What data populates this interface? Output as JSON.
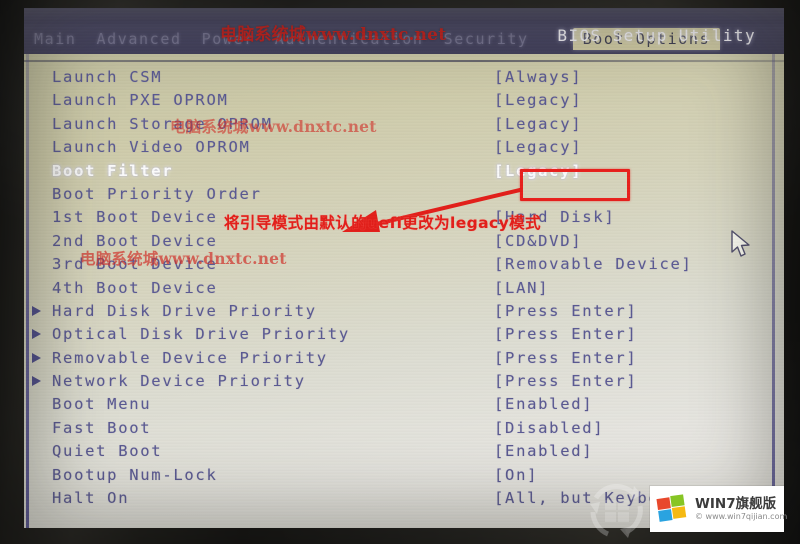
{
  "window": {
    "title": "BIOS Setup Utility"
  },
  "menubar": {
    "tabs": [
      {
        "label": "Main",
        "active": false
      },
      {
        "label": "Advanced",
        "active": false
      },
      {
        "label": "Power",
        "active": false
      },
      {
        "label": "Authentication",
        "active": false
      },
      {
        "label": "Security",
        "active": false
      },
      {
        "label": "Boot Options",
        "active": true
      }
    ]
  },
  "settings": {
    "rows": [
      {
        "label": "Launch CSM",
        "value": "[Always]",
        "arrow": false,
        "selected": false
      },
      {
        "label": "Launch PXE OPROM",
        "value": "[Legacy]",
        "arrow": false,
        "selected": false
      },
      {
        "label": "Launch Storage OPROM",
        "value": "[Legacy]",
        "arrow": false,
        "selected": false
      },
      {
        "label": "Launch Video OPROM",
        "value": "[Legacy]",
        "arrow": false,
        "selected": false
      },
      {
        "label": "Boot Filter",
        "value": "[Legacy]",
        "arrow": false,
        "selected": true
      },
      {
        "label": "Boot Priority Order",
        "value": "",
        "arrow": false,
        "selected": false
      },
      {
        "label": "1st Boot Device",
        "value": "[Hard Disk]",
        "arrow": false,
        "selected": false
      },
      {
        "label": "2nd Boot Device",
        "value": "[CD&DVD]",
        "arrow": false,
        "selected": false
      },
      {
        "label": "3rd Boot Device",
        "value": "[Removable Device]",
        "arrow": false,
        "selected": false
      },
      {
        "label": "4th Boot Device",
        "value": "[LAN]",
        "arrow": false,
        "selected": false
      },
      {
        "label": "Hard Disk Drive Priority",
        "value": "[Press Enter]",
        "arrow": true,
        "selected": false
      },
      {
        "label": "Optical Disk Drive Priority",
        "value": "[Press Enter]",
        "arrow": true,
        "selected": false
      },
      {
        "label": "Removable Device Priority",
        "value": "[Press Enter]",
        "arrow": true,
        "selected": false
      },
      {
        "label": "Network Device Priority",
        "value": "[Press Enter]",
        "arrow": true,
        "selected": false
      },
      {
        "label": "Boot Menu",
        "value": "[Enabled]",
        "arrow": false,
        "selected": false
      },
      {
        "label": "Fast Boot",
        "value": "[Disabled]",
        "arrow": false,
        "selected": false
      },
      {
        "label": "Quiet Boot",
        "value": "[Enabled]",
        "arrow": false,
        "selected": false
      },
      {
        "label": "Bootup Num-Lock",
        "value": "[On]",
        "arrow": false,
        "selected": false
      },
      {
        "label": "Halt On",
        "value": "[All, but Keyboard]",
        "arrow": false,
        "selected": false
      }
    ]
  },
  "annotation": {
    "text": "将引导模式由默认的uefi更改为legacy模式",
    "color": "#e31f1a",
    "highlight_target": "[Legacy]"
  },
  "watermarks": [
    {
      "text": "电脑系统城www.dnxtc.net"
    },
    {
      "text": "电脑系统城www.dnxtc.net"
    },
    {
      "text": "电脑系统城www.dnxtc.net"
    }
  ],
  "badge": {
    "title": "WIN7旗舰版",
    "subtitle": "© www.win7qijian.com"
  },
  "colors": {
    "panel_bg": "#d6d4bc",
    "text": "#5b5a93",
    "menubar_bg": "#494765",
    "active_tab_bg": "#cfcaa4",
    "annotation_red": "#e31f1a",
    "selected_text": "#fbfbfb"
  }
}
